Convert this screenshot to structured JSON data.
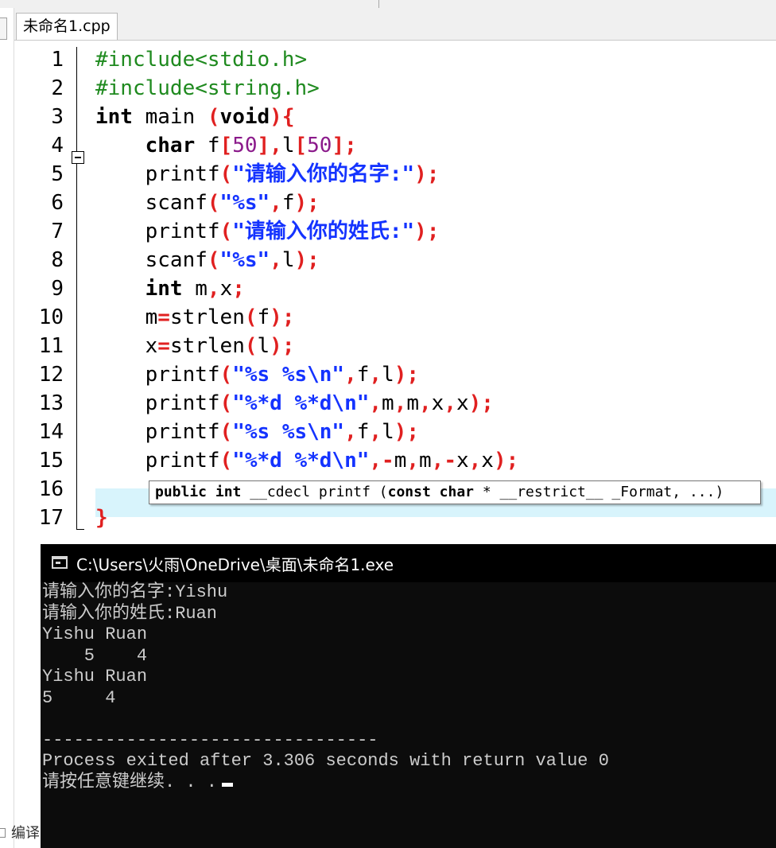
{
  "tab": {
    "label": "未命名1.cpp"
  },
  "editor": {
    "lines": [
      {
        "num": "1",
        "tokens": [
          {
            "t": "pp",
            "v": "#include<stdio.h>"
          }
        ]
      },
      {
        "num": "2",
        "tokens": [
          {
            "t": "pp",
            "v": "#include<string.h>"
          }
        ]
      },
      {
        "num": "3",
        "tokens": [
          {
            "t": "kw",
            "v": "int"
          },
          {
            "t": "",
            "v": " main "
          },
          {
            "t": "sym",
            "v": "("
          },
          {
            "t": "kw",
            "v": "void"
          },
          {
            "t": "sym",
            "v": "){"
          }
        ]
      },
      {
        "num": "4",
        "tokens": [
          {
            "t": "",
            "v": "    "
          },
          {
            "t": "kw",
            "v": "char"
          },
          {
            "t": "",
            "v": " f"
          },
          {
            "t": "sym",
            "v": "["
          },
          {
            "t": "num",
            "v": "50"
          },
          {
            "t": "sym",
            "v": "],"
          },
          {
            "t": "",
            "v": "l"
          },
          {
            "t": "sym",
            "v": "["
          },
          {
            "t": "num",
            "v": "50"
          },
          {
            "t": "sym",
            "v": "];"
          }
        ]
      },
      {
        "num": "5",
        "tokens": [
          {
            "t": "",
            "v": "    printf"
          },
          {
            "t": "sym",
            "v": "("
          },
          {
            "t": "str",
            "v": "\"请输入你的名字:\""
          },
          {
            "t": "sym",
            "v": ");"
          }
        ]
      },
      {
        "num": "6",
        "tokens": [
          {
            "t": "",
            "v": "    scanf"
          },
          {
            "t": "sym",
            "v": "("
          },
          {
            "t": "str",
            "v": "\"%s\""
          },
          {
            "t": "sym",
            "v": ","
          },
          {
            "t": "",
            "v": "f"
          },
          {
            "t": "sym",
            "v": ");"
          }
        ]
      },
      {
        "num": "7",
        "tokens": [
          {
            "t": "",
            "v": "    printf"
          },
          {
            "t": "sym",
            "v": "("
          },
          {
            "t": "str",
            "v": "\"请输入你的姓氏:\""
          },
          {
            "t": "sym",
            "v": ");"
          }
        ]
      },
      {
        "num": "8",
        "tokens": [
          {
            "t": "",
            "v": "    scanf"
          },
          {
            "t": "sym",
            "v": "("
          },
          {
            "t": "str",
            "v": "\"%s\""
          },
          {
            "t": "sym",
            "v": ","
          },
          {
            "t": "",
            "v": "l"
          },
          {
            "t": "sym",
            "v": ");"
          }
        ]
      },
      {
        "num": "9",
        "tokens": [
          {
            "t": "",
            "v": "    "
          },
          {
            "t": "kw",
            "v": "int"
          },
          {
            "t": "",
            "v": " m"
          },
          {
            "t": "sym",
            "v": ","
          },
          {
            "t": "",
            "v": "x"
          },
          {
            "t": "sym",
            "v": ";"
          }
        ]
      },
      {
        "num": "10",
        "tokens": [
          {
            "t": "",
            "v": "    m"
          },
          {
            "t": "sym",
            "v": "="
          },
          {
            "t": "",
            "v": "strlen"
          },
          {
            "t": "sym",
            "v": "("
          },
          {
            "t": "",
            "v": "f"
          },
          {
            "t": "sym",
            "v": ");"
          }
        ]
      },
      {
        "num": "11",
        "tokens": [
          {
            "t": "",
            "v": "    x"
          },
          {
            "t": "sym",
            "v": "="
          },
          {
            "t": "",
            "v": "strlen"
          },
          {
            "t": "sym",
            "v": "("
          },
          {
            "t": "",
            "v": "l"
          },
          {
            "t": "sym",
            "v": ");"
          }
        ]
      },
      {
        "num": "12",
        "tokens": [
          {
            "t": "",
            "v": "    printf"
          },
          {
            "t": "sym",
            "v": "("
          },
          {
            "t": "str",
            "v": "\"%s %s\\n\""
          },
          {
            "t": "sym",
            "v": ","
          },
          {
            "t": "",
            "v": "f"
          },
          {
            "t": "sym",
            "v": ","
          },
          {
            "t": "",
            "v": "l"
          },
          {
            "t": "sym",
            "v": ");"
          }
        ]
      },
      {
        "num": "13",
        "tokens": [
          {
            "t": "",
            "v": "    printf"
          },
          {
            "t": "sym",
            "v": "("
          },
          {
            "t": "str",
            "v": "\"%*d %*d\\n\""
          },
          {
            "t": "sym",
            "v": ","
          },
          {
            "t": "",
            "v": "m"
          },
          {
            "t": "sym",
            "v": ","
          },
          {
            "t": "",
            "v": "m"
          },
          {
            "t": "sym",
            "v": ","
          },
          {
            "t": "",
            "v": "x"
          },
          {
            "t": "sym",
            "v": ","
          },
          {
            "t": "",
            "v": "x"
          },
          {
            "t": "sym",
            "v": ");"
          }
        ]
      },
      {
        "num": "14",
        "tokens": [
          {
            "t": "",
            "v": "    printf"
          },
          {
            "t": "sym",
            "v": "("
          },
          {
            "t": "str",
            "v": "\"%s %s\\n\""
          },
          {
            "t": "sym",
            "v": ","
          },
          {
            "t": "",
            "v": "f"
          },
          {
            "t": "sym",
            "v": ","
          },
          {
            "t": "",
            "v": "l"
          },
          {
            "t": "sym",
            "v": ");"
          }
        ]
      },
      {
        "num": "15",
        "tokens": [
          {
            "t": "",
            "v": "    printf"
          },
          {
            "t": "sym",
            "v": "("
          },
          {
            "t": "str",
            "v": "\"%*d %*d\\n\""
          },
          {
            "t": "sym",
            "v": ",-"
          },
          {
            "t": "",
            "v": "m"
          },
          {
            "t": "sym",
            "v": ","
          },
          {
            "t": "",
            "v": "m"
          },
          {
            "t": "sym",
            "v": ",-"
          },
          {
            "t": "",
            "v": "x"
          },
          {
            "t": "sym",
            "v": ","
          },
          {
            "t": "",
            "v": "x"
          },
          {
            "t": "sym",
            "v": ");"
          }
        ]
      },
      {
        "num": "16",
        "tokens": []
      },
      {
        "num": "17",
        "tokens": [
          {
            "t": "sym",
            "v": "}"
          }
        ]
      }
    ],
    "highlight_line": "15"
  },
  "tooltip": {
    "kw1": "public",
    "kw2": "int",
    "rest1": " __cdecl printf (",
    "kw3": "const",
    "kw4": "char",
    "rest2": " * __restrict__ _Format, ...)"
  },
  "console": {
    "title": "C:\\Users\\火雨\\OneDrive\\桌面\\未命名1.exe",
    "lines": [
      "请输入你的名字:Yishu",
      "请输入你的姓氏:Ruan",
      "Yishu Ruan",
      "    5    4",
      "Yishu Ruan",
      "5     4",
      "",
      "--------------------------------",
      "Process exited after 3.306 seconds with return value 0",
      "请按任意键继续. . ."
    ]
  },
  "bottom_panel": {
    "label": "编译"
  },
  "colors": {
    "preprocessor": "#1f8a1f",
    "keyword": "#000000",
    "string": "#1433ff",
    "number": "#8b1a8b",
    "symbol": "#e02020",
    "highlight": "#d8f4fc",
    "console_bg": "#0c0c0c"
  },
  "icons": [
    "fold-minus-icon",
    "console-window-icon"
  ]
}
